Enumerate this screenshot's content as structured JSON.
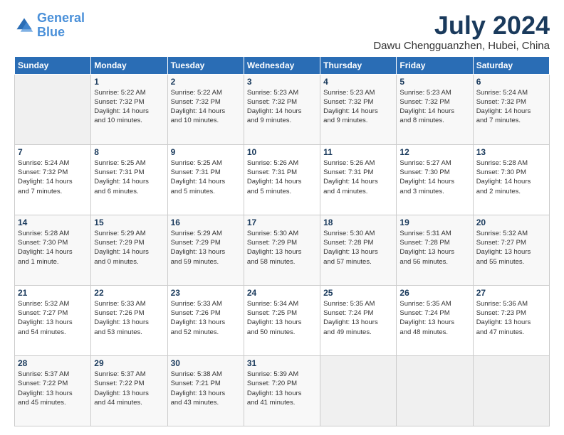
{
  "header": {
    "logo_line1": "General",
    "logo_line2": "Blue",
    "month_year": "July 2024",
    "location": "Dawu Chengguanzhen, Hubei, China"
  },
  "weekdays": [
    "Sunday",
    "Monday",
    "Tuesday",
    "Wednesday",
    "Thursday",
    "Friday",
    "Saturday"
  ],
  "weeks": [
    [
      {
        "day": "",
        "info": ""
      },
      {
        "day": "1",
        "info": "Sunrise: 5:22 AM\nSunset: 7:32 PM\nDaylight: 14 hours\nand 10 minutes."
      },
      {
        "day": "2",
        "info": "Sunrise: 5:22 AM\nSunset: 7:32 PM\nDaylight: 14 hours\nand 10 minutes."
      },
      {
        "day": "3",
        "info": "Sunrise: 5:23 AM\nSunset: 7:32 PM\nDaylight: 14 hours\nand 9 minutes."
      },
      {
        "day": "4",
        "info": "Sunrise: 5:23 AM\nSunset: 7:32 PM\nDaylight: 14 hours\nand 9 minutes."
      },
      {
        "day": "5",
        "info": "Sunrise: 5:23 AM\nSunset: 7:32 PM\nDaylight: 14 hours\nand 8 minutes."
      },
      {
        "day": "6",
        "info": "Sunrise: 5:24 AM\nSunset: 7:32 PM\nDaylight: 14 hours\nand 7 minutes."
      }
    ],
    [
      {
        "day": "7",
        "info": "Sunrise: 5:24 AM\nSunset: 7:32 PM\nDaylight: 14 hours\nand 7 minutes."
      },
      {
        "day": "8",
        "info": "Sunrise: 5:25 AM\nSunset: 7:31 PM\nDaylight: 14 hours\nand 6 minutes."
      },
      {
        "day": "9",
        "info": "Sunrise: 5:25 AM\nSunset: 7:31 PM\nDaylight: 14 hours\nand 5 minutes."
      },
      {
        "day": "10",
        "info": "Sunrise: 5:26 AM\nSunset: 7:31 PM\nDaylight: 14 hours\nand 5 minutes."
      },
      {
        "day": "11",
        "info": "Sunrise: 5:26 AM\nSunset: 7:31 PM\nDaylight: 14 hours\nand 4 minutes."
      },
      {
        "day": "12",
        "info": "Sunrise: 5:27 AM\nSunset: 7:30 PM\nDaylight: 14 hours\nand 3 minutes."
      },
      {
        "day": "13",
        "info": "Sunrise: 5:28 AM\nSunset: 7:30 PM\nDaylight: 14 hours\nand 2 minutes."
      }
    ],
    [
      {
        "day": "14",
        "info": "Sunrise: 5:28 AM\nSunset: 7:30 PM\nDaylight: 14 hours\nand 1 minute."
      },
      {
        "day": "15",
        "info": "Sunrise: 5:29 AM\nSunset: 7:29 PM\nDaylight: 14 hours\nand 0 minutes."
      },
      {
        "day": "16",
        "info": "Sunrise: 5:29 AM\nSunset: 7:29 PM\nDaylight: 13 hours\nand 59 minutes."
      },
      {
        "day": "17",
        "info": "Sunrise: 5:30 AM\nSunset: 7:29 PM\nDaylight: 13 hours\nand 58 minutes."
      },
      {
        "day": "18",
        "info": "Sunrise: 5:30 AM\nSunset: 7:28 PM\nDaylight: 13 hours\nand 57 minutes."
      },
      {
        "day": "19",
        "info": "Sunrise: 5:31 AM\nSunset: 7:28 PM\nDaylight: 13 hours\nand 56 minutes."
      },
      {
        "day": "20",
        "info": "Sunrise: 5:32 AM\nSunset: 7:27 PM\nDaylight: 13 hours\nand 55 minutes."
      }
    ],
    [
      {
        "day": "21",
        "info": "Sunrise: 5:32 AM\nSunset: 7:27 PM\nDaylight: 13 hours\nand 54 minutes."
      },
      {
        "day": "22",
        "info": "Sunrise: 5:33 AM\nSunset: 7:26 PM\nDaylight: 13 hours\nand 53 minutes."
      },
      {
        "day": "23",
        "info": "Sunrise: 5:33 AM\nSunset: 7:26 PM\nDaylight: 13 hours\nand 52 minutes."
      },
      {
        "day": "24",
        "info": "Sunrise: 5:34 AM\nSunset: 7:25 PM\nDaylight: 13 hours\nand 50 minutes."
      },
      {
        "day": "25",
        "info": "Sunrise: 5:35 AM\nSunset: 7:24 PM\nDaylight: 13 hours\nand 49 minutes."
      },
      {
        "day": "26",
        "info": "Sunrise: 5:35 AM\nSunset: 7:24 PM\nDaylight: 13 hours\nand 48 minutes."
      },
      {
        "day": "27",
        "info": "Sunrise: 5:36 AM\nSunset: 7:23 PM\nDaylight: 13 hours\nand 47 minutes."
      }
    ],
    [
      {
        "day": "28",
        "info": "Sunrise: 5:37 AM\nSunset: 7:22 PM\nDaylight: 13 hours\nand 45 minutes."
      },
      {
        "day": "29",
        "info": "Sunrise: 5:37 AM\nSunset: 7:22 PM\nDaylight: 13 hours\nand 44 minutes."
      },
      {
        "day": "30",
        "info": "Sunrise: 5:38 AM\nSunset: 7:21 PM\nDaylight: 13 hours\nand 43 minutes."
      },
      {
        "day": "31",
        "info": "Sunrise: 5:39 AM\nSunset: 7:20 PM\nDaylight: 13 hours\nand 41 minutes."
      },
      {
        "day": "",
        "info": ""
      },
      {
        "day": "",
        "info": ""
      },
      {
        "day": "",
        "info": ""
      }
    ]
  ]
}
